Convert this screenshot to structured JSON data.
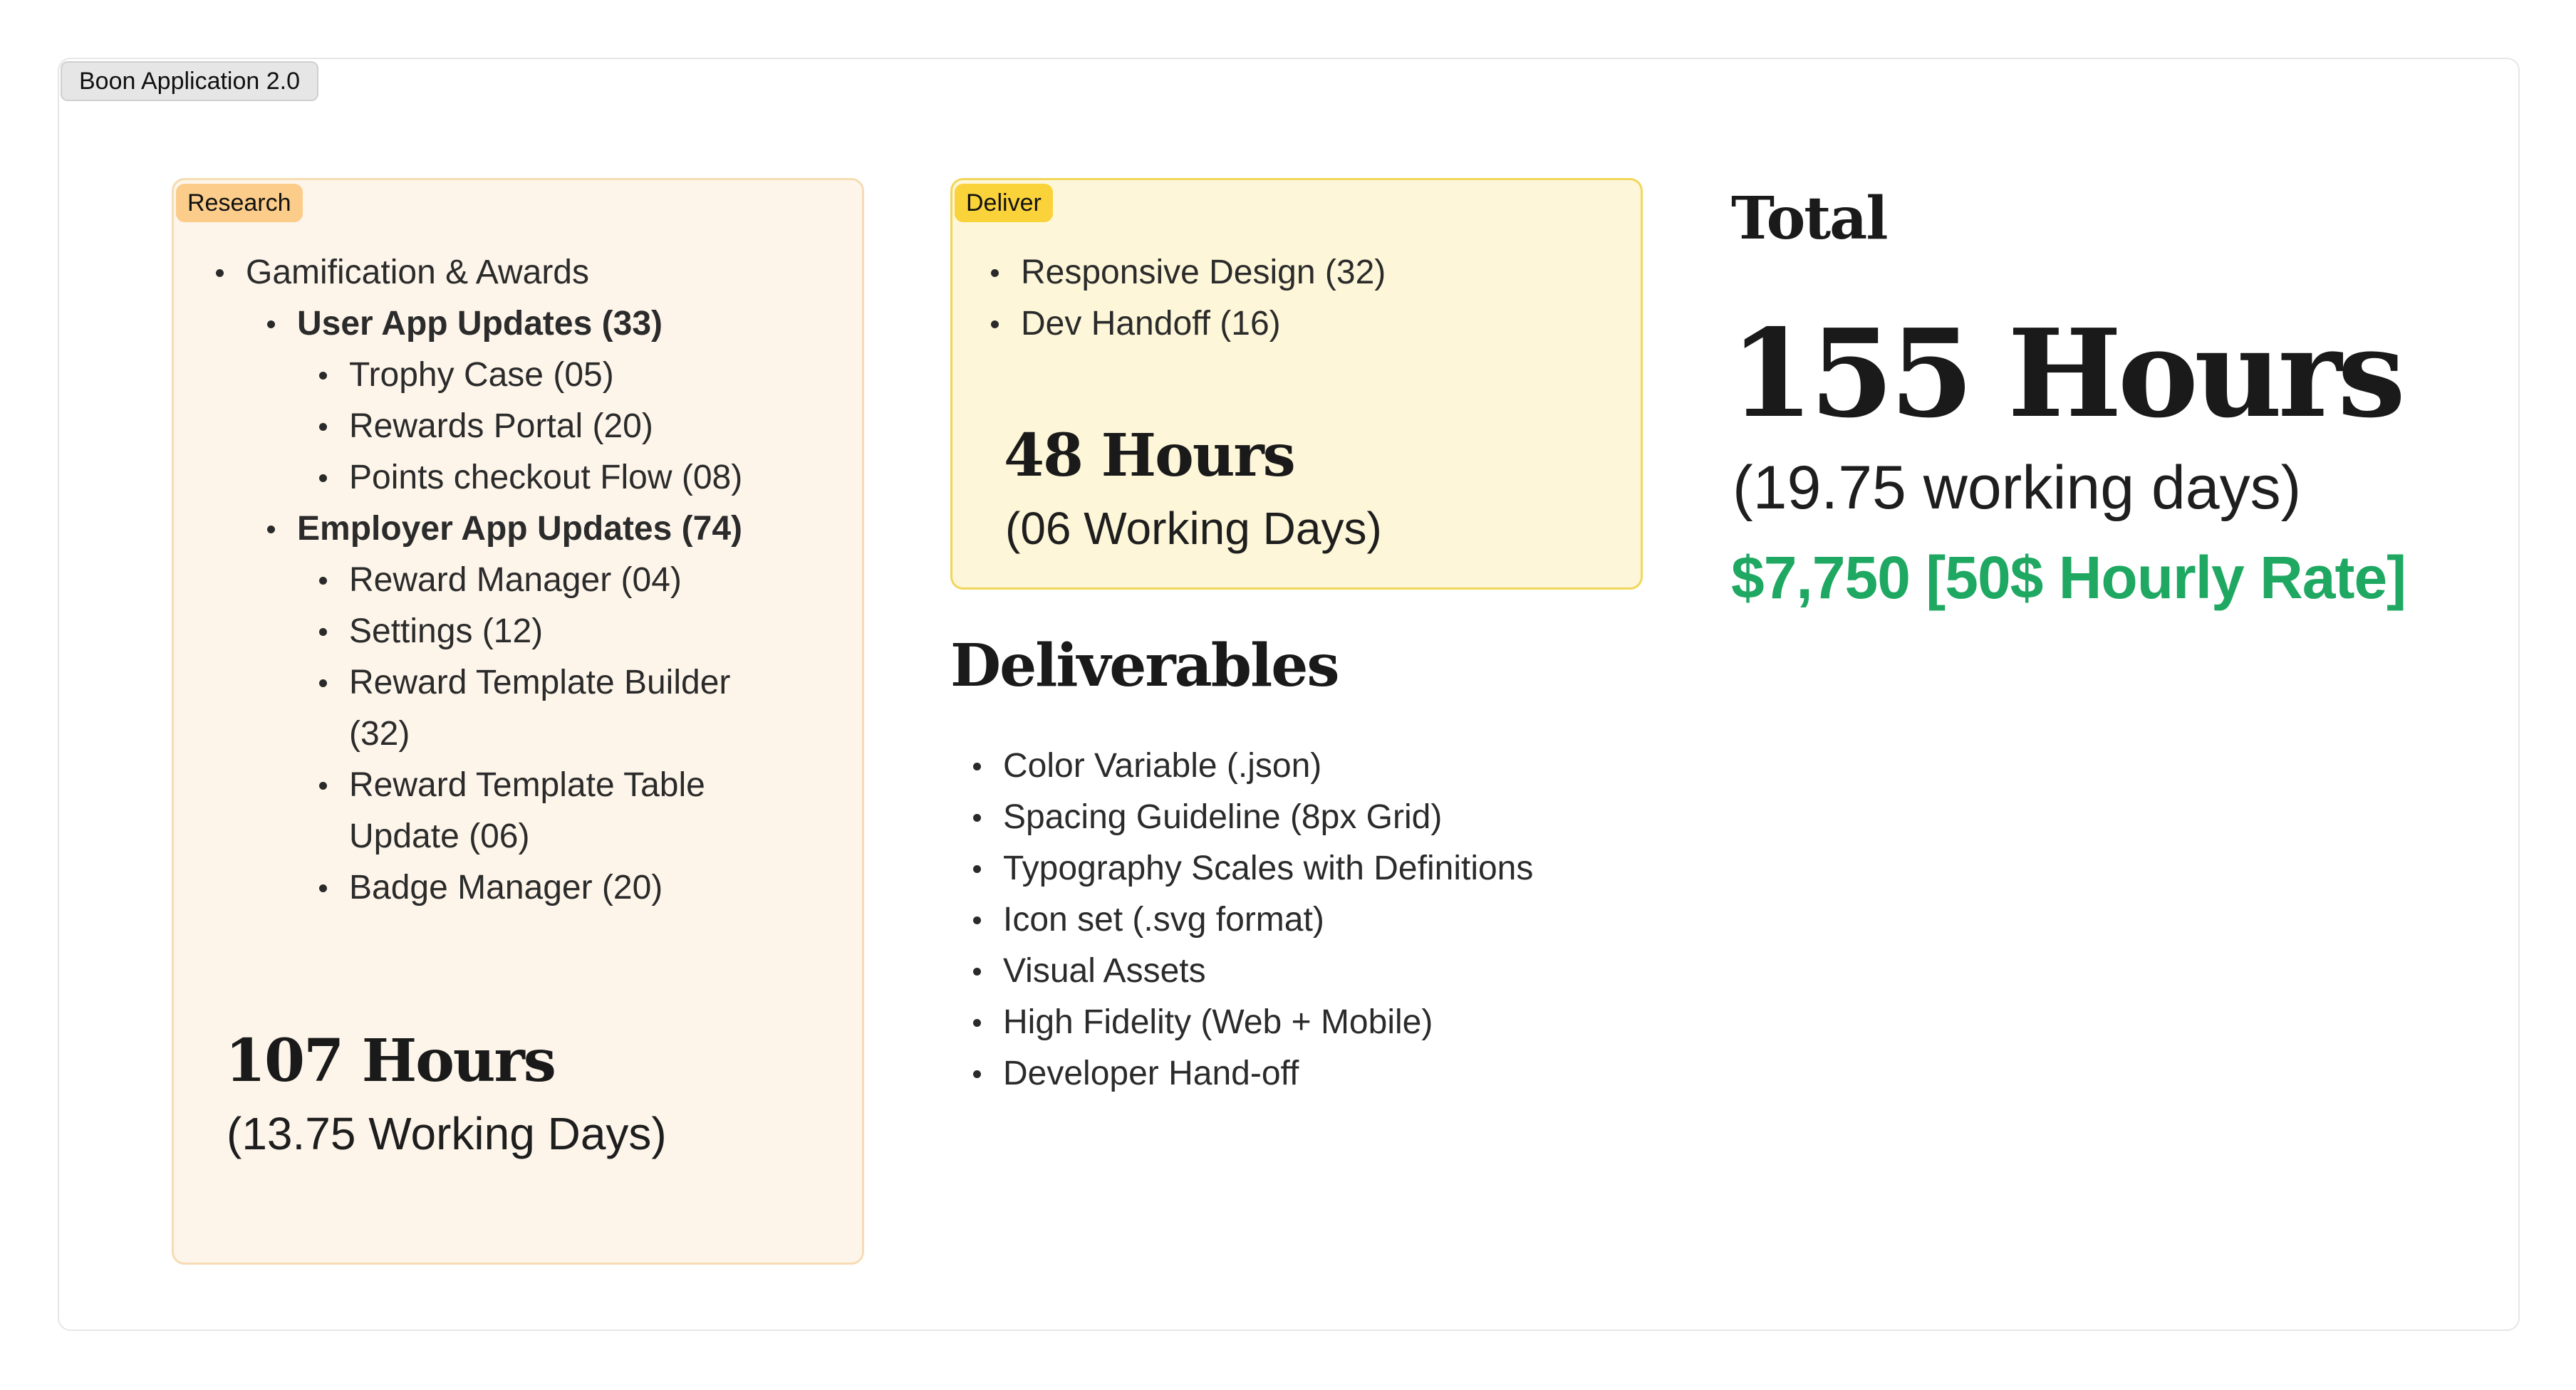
{
  "frame": {
    "title": "Boon Application 2.0"
  },
  "research": {
    "tag": "Research",
    "items": {
      "gamification": "Gamification & Awards",
      "user_app_updates": "User App Updates (33)",
      "trophy_case": "Trophy Case (05)",
      "rewards_portal": "Rewards Portal (20)",
      "points_checkout": "Points checkout Flow (08)",
      "employer_app_updates": "Employer App Updates (74)",
      "reward_manager": "Reward Manager (04)",
      "settings": "Settings (12)",
      "reward_template_builder": "Reward Template Builder (32)",
      "reward_template_table": "Reward Template Table Update (06)",
      "badge_manager": "Badge Manager (20)"
    },
    "hours": "107 Hours",
    "days": "(13.75 Working Days)"
  },
  "deliver": {
    "tag": "Deliver",
    "items": {
      "responsive_design": "Responsive Design (32)",
      "dev_handoff": "Dev Handoff (16)"
    },
    "hours": "48 Hours",
    "days": "(06 Working Days)"
  },
  "deliverables": {
    "heading": "Deliverables",
    "items": [
      "Color Variable (.json)",
      "Spacing Guideline (8px Grid)",
      "Typography Scales with Definitions",
      "Icon set (.svg format)",
      "Visual Assets",
      "High Fidelity  (Web + Mobile)",
      "Developer Hand-off"
    ]
  },
  "total": {
    "label": "Total",
    "hours": "155 Hours",
    "days": "(19.75 working days)",
    "cost": "$7,750 [50$ Hourly Rate]"
  },
  "colors": {
    "research_bg": "#fdf5ea",
    "research_tag": "#fccd8a",
    "deliver_bg": "#fdf6d8",
    "deliver_tag": "#fad23a",
    "cost_green": "#1fa862"
  }
}
